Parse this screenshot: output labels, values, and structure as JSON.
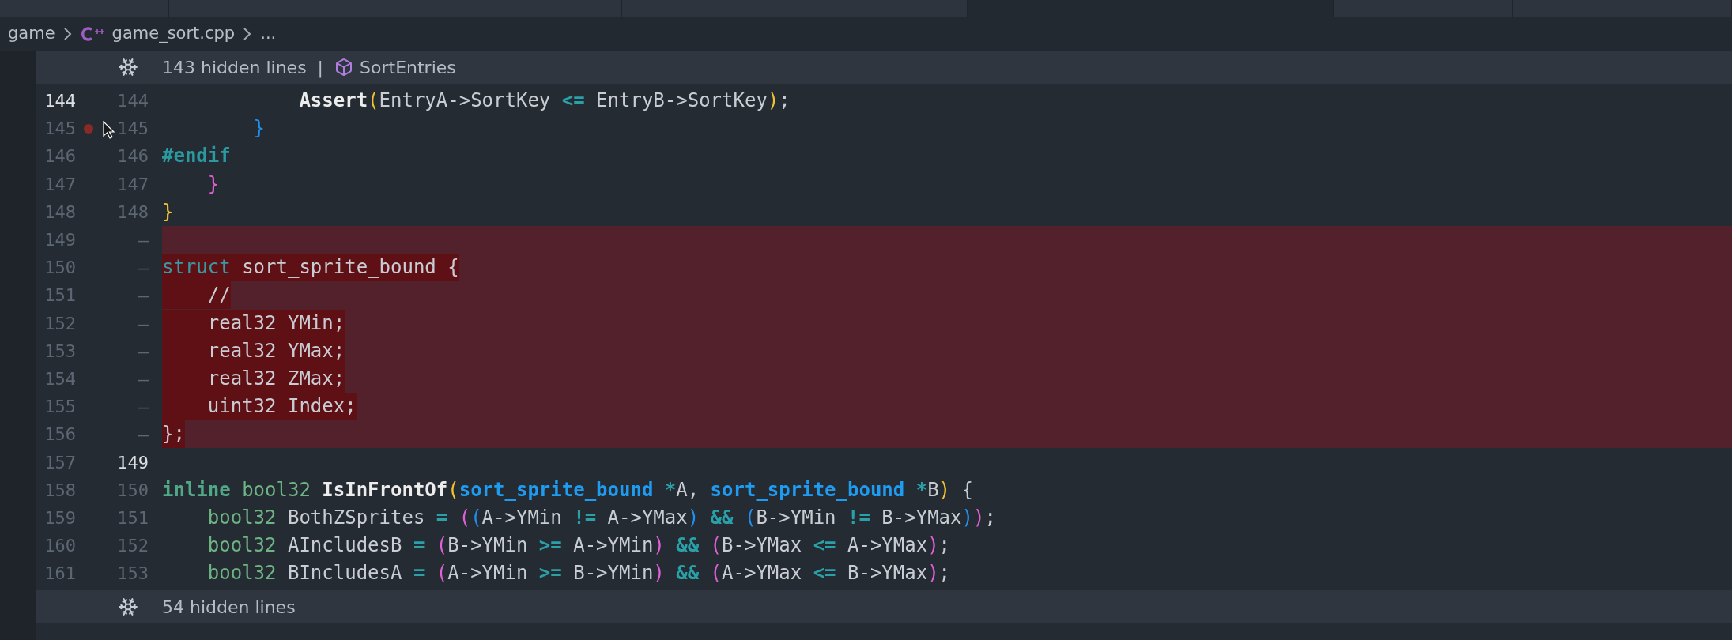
{
  "tabs": [
    {
      "selected": false
    },
    {
      "selected": false
    },
    {
      "selected": false
    },
    {
      "selected": false
    },
    {
      "selected": true
    },
    {
      "selected": false
    },
    {
      "selected": false
    }
  ],
  "breadcrumb": {
    "folder": "game",
    "file": "game_sort.cpp",
    "more": "..."
  },
  "top_fold": {
    "label": "143 hidden lines",
    "separator": "|",
    "symbol": "SortEntries"
  },
  "lines": [
    {
      "old": "144",
      "new": "144",
      "old_active": true,
      "new_active": false,
      "deleted": false,
      "breakpoint": false,
      "tokens": [
        {
          "text": "            Assert",
          "kind": "func"
        },
        {
          "text": "(",
          "kind": "paren1"
        },
        {
          "text": "EntryA->SortKey ",
          "kind": "plain"
        },
        {
          "text": "<=",
          "kind": "op"
        },
        {
          "text": " EntryB->SortKey",
          "kind": "plain"
        },
        {
          "text": ")",
          "kind": "paren1"
        },
        {
          "text": ";",
          "kind": "plain"
        }
      ]
    },
    {
      "old": "145",
      "new": "145",
      "old_active": false,
      "new_active": false,
      "deleted": false,
      "breakpoint": true,
      "tokens": [
        {
          "text": "        }",
          "kind": "paren3"
        }
      ]
    },
    {
      "old": "146",
      "new": "146",
      "old_active": false,
      "new_active": false,
      "deleted": false,
      "breakpoint": false,
      "tokens": [
        {
          "text": "#endif",
          "kind": "preproc"
        }
      ]
    },
    {
      "old": "147",
      "new": "147",
      "old_active": false,
      "new_active": false,
      "deleted": false,
      "breakpoint": false,
      "tokens": [
        {
          "text": "    }",
          "kind": "paren2"
        }
      ]
    },
    {
      "old": "148",
      "new": "148",
      "old_active": false,
      "new_active": false,
      "deleted": false,
      "breakpoint": false,
      "tokens": [
        {
          "text": "}",
          "kind": "paren1"
        }
      ]
    },
    {
      "old": "149",
      "new": "—",
      "old_active": false,
      "new_active": false,
      "deleted": true,
      "breakpoint": false
    },
    {
      "old": "150",
      "new": "—",
      "old_active": false,
      "new_active": false,
      "deleted": true,
      "breakpoint": false,
      "tokens": [
        {
          "text": "struct",
          "kind": "keyword"
        },
        {
          "text": " sort_sprite_bound {",
          "kind": "plain"
        }
      ]
    },
    {
      "old": "151",
      "new": "—",
      "old_active": false,
      "new_active": false,
      "deleted": true,
      "breakpoint": false,
      "tokens": [
        {
          "text": "    //",
          "kind": "plain"
        }
      ]
    },
    {
      "old": "152",
      "new": "—",
      "old_active": false,
      "new_active": false,
      "deleted": true,
      "breakpoint": false,
      "tokens": [
        {
          "text": "    real32 YMin;",
          "kind": "plain"
        }
      ]
    },
    {
      "old": "153",
      "new": "—",
      "old_active": false,
      "new_active": false,
      "deleted": true,
      "breakpoint": false,
      "tokens": [
        {
          "text": "    real32 YMax;",
          "kind": "plain"
        }
      ]
    },
    {
      "old": "154",
      "new": "—",
      "old_active": false,
      "new_active": false,
      "deleted": true,
      "breakpoint": false,
      "tokens": [
        {
          "text": "    real32 ZMax;",
          "kind": "plain"
        }
      ]
    },
    {
      "old": "155",
      "new": "—",
      "old_active": false,
      "new_active": false,
      "deleted": true,
      "breakpoint": false,
      "tokens": [
        {
          "text": "    uint32 Index;",
          "kind": "plain"
        }
      ]
    },
    {
      "old": "156",
      "new": "—",
      "old_active": false,
      "new_active": false,
      "deleted": true,
      "breakpoint": false,
      "tokens": [
        {
          "text": "};",
          "kind": "plain"
        }
      ]
    },
    {
      "old": "157",
      "new": "149",
      "old_active": false,
      "new_active": true,
      "deleted": false,
      "breakpoint": false
    },
    {
      "old": "158",
      "new": "150",
      "old_active": false,
      "new_active": false,
      "deleted": false,
      "breakpoint": false,
      "tokens": [
        {
          "text": "inline",
          "kind": "keyword2"
        },
        {
          "text": " bool32",
          "kind": "type"
        },
        {
          "text": " IsInFrontOf",
          "kind": "func"
        },
        {
          "text": "(",
          "kind": "paren1"
        },
        {
          "text": "sort_sprite_bound",
          "kind": "ptype"
        },
        {
          "text": " *",
          "kind": "op"
        },
        {
          "text": "A, ",
          "kind": "plain"
        },
        {
          "text": "sort_sprite_bound",
          "kind": "ptype"
        },
        {
          "text": " *",
          "kind": "op"
        },
        {
          "text": "B",
          "kind": "plain"
        },
        {
          "text": ")",
          "kind": "paren1"
        },
        {
          "text": " {",
          "kind": "plain"
        }
      ]
    },
    {
      "old": "159",
      "new": "151",
      "old_active": false,
      "new_active": false,
      "deleted": false,
      "breakpoint": false,
      "tokens": [
        {
          "text": "    bool32",
          "kind": "type"
        },
        {
          "text": " BothZSprites ",
          "kind": "plain"
        },
        {
          "text": "= ",
          "kind": "op"
        },
        {
          "text": "(",
          "kind": "paren2"
        },
        {
          "text": "(",
          "kind": "paren3"
        },
        {
          "text": "A->YMin ",
          "kind": "plain"
        },
        {
          "text": "!=",
          "kind": "op"
        },
        {
          "text": " A->YMax",
          "kind": "plain"
        },
        {
          "text": ")",
          "kind": "paren3"
        },
        {
          "text": " &&",
          "kind": "op"
        },
        {
          "text": " (",
          "kind": "paren3"
        },
        {
          "text": "B->YMin ",
          "kind": "plain"
        },
        {
          "text": "!=",
          "kind": "op"
        },
        {
          "text": " B->YMax",
          "kind": "plain"
        },
        {
          "text": ")",
          "kind": "paren3"
        },
        {
          "text": ")",
          "kind": "paren2"
        },
        {
          "text": ";",
          "kind": "plain"
        }
      ]
    },
    {
      "old": "160",
      "new": "152",
      "old_active": false,
      "new_active": false,
      "deleted": false,
      "breakpoint": false,
      "tokens": [
        {
          "text": "    bool32",
          "kind": "type"
        },
        {
          "text": " AIncludesB ",
          "kind": "plain"
        },
        {
          "text": "= ",
          "kind": "op"
        },
        {
          "text": "(",
          "kind": "paren2"
        },
        {
          "text": "B->YMin ",
          "kind": "plain"
        },
        {
          "text": ">=",
          "kind": "op"
        },
        {
          "text": " A->YMin",
          "kind": "plain"
        },
        {
          "text": ")",
          "kind": "paren2"
        },
        {
          "text": " &&",
          "kind": "op"
        },
        {
          "text": " (",
          "kind": "paren2"
        },
        {
          "text": "B->YMax ",
          "kind": "plain"
        },
        {
          "text": "<=",
          "kind": "op"
        },
        {
          "text": " A->YMax",
          "kind": "plain"
        },
        {
          "text": ")",
          "kind": "paren2"
        },
        {
          "text": ";",
          "kind": "plain"
        }
      ]
    },
    {
      "old": "161",
      "new": "153",
      "old_active": false,
      "new_active": false,
      "deleted": false,
      "breakpoint": false,
      "tokens": [
        {
          "text": "    bool32",
          "kind": "type"
        },
        {
          "text": " BIncludesA ",
          "kind": "plain"
        },
        {
          "text": "= ",
          "kind": "op"
        },
        {
          "text": "(",
          "kind": "paren2"
        },
        {
          "text": "A->YMin ",
          "kind": "plain"
        },
        {
          "text": ">=",
          "kind": "op"
        },
        {
          "text": " B->YMin",
          "kind": "plain"
        },
        {
          "text": ")",
          "kind": "paren2"
        },
        {
          "text": " &&",
          "kind": "op"
        },
        {
          "text": " (",
          "kind": "paren2"
        },
        {
          "text": "A->YMax ",
          "kind": "plain"
        },
        {
          "text": "<=",
          "kind": "op"
        },
        {
          "text": " B->YMax",
          "kind": "plain"
        },
        {
          "text": ")",
          "kind": "paren2"
        },
        {
          "text": ";",
          "kind": "plain"
        }
      ]
    }
  ],
  "bottom_fold": {
    "label": "54 hidden lines"
  }
}
